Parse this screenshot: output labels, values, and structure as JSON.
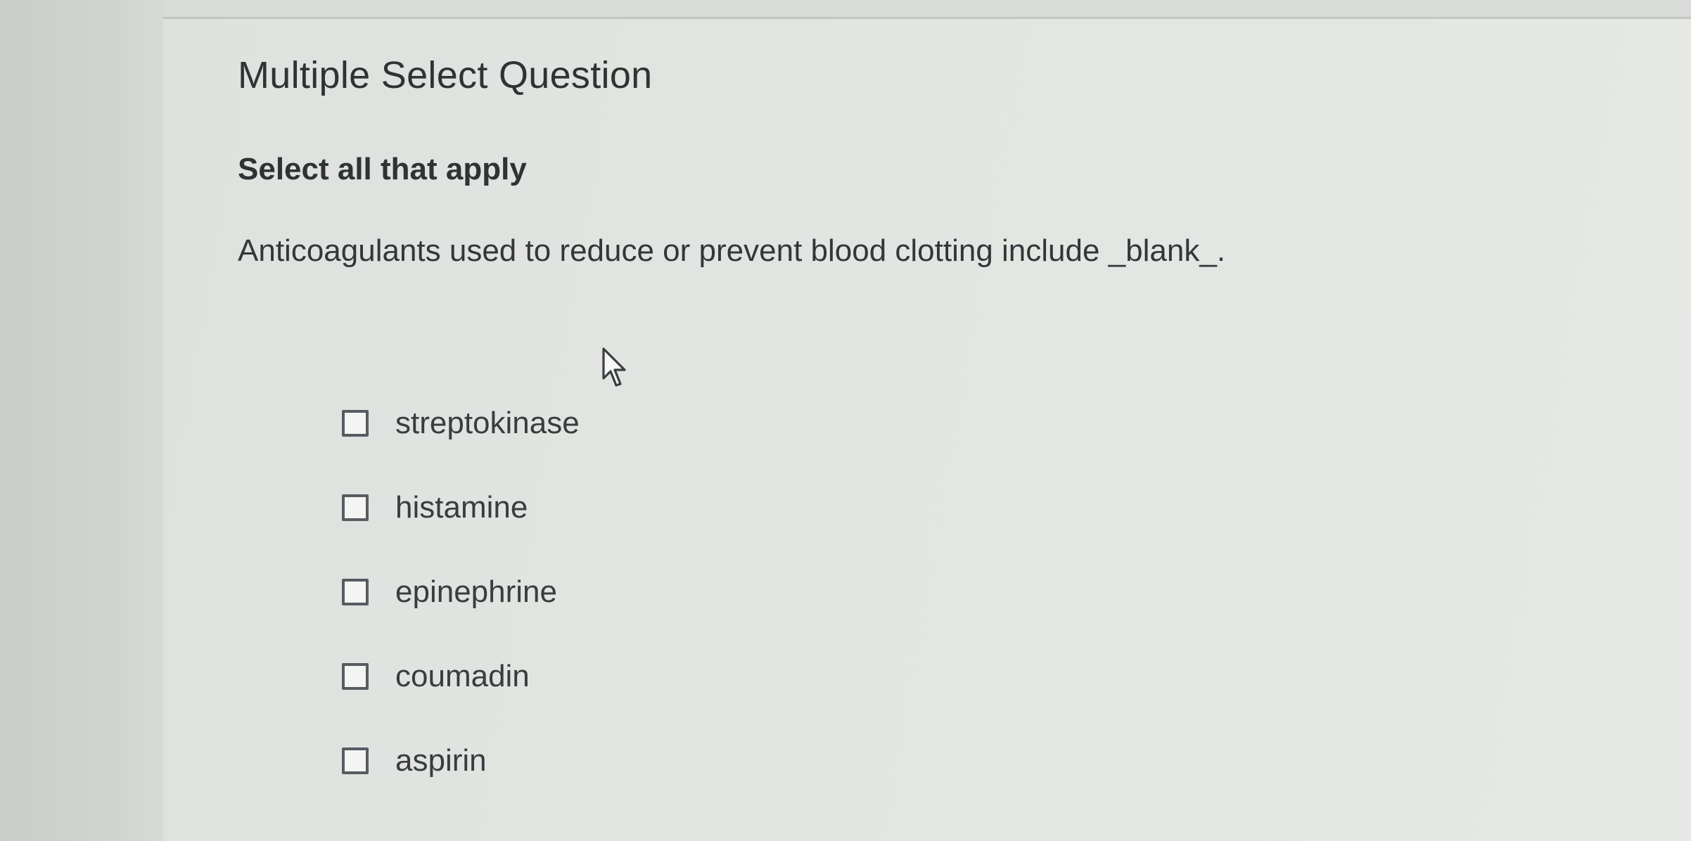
{
  "question": {
    "title": "Multiple Select Question",
    "instruction": "Select all that apply",
    "prompt": "Anticoagulants used to reduce or prevent blood clotting include _blank_."
  },
  "options": [
    {
      "label": "streptokinase",
      "checked": false
    },
    {
      "label": "histamine",
      "checked": false
    },
    {
      "label": "epinephrine",
      "checked": false
    },
    {
      "label": "coumadin",
      "checked": false
    },
    {
      "label": "aspirin",
      "checked": false
    }
  ],
  "cursor": {
    "icon": "mouse-pointer-icon"
  }
}
